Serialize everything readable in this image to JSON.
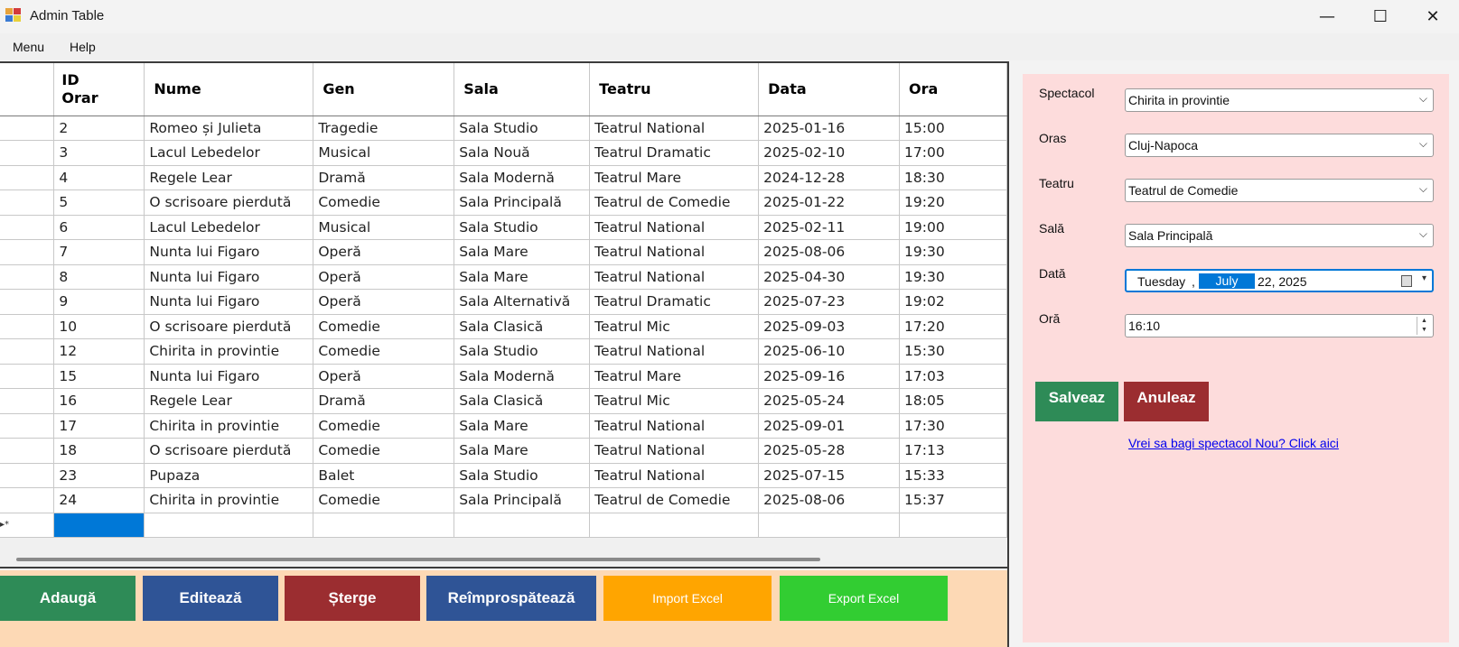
{
  "window": {
    "title": "Admin Table",
    "minimize_glyph": "—",
    "maximize_glyph": "☐",
    "close_glyph": "✕"
  },
  "menu": [
    "Menu",
    "Help"
  ],
  "table": {
    "columns": [
      "ID Orar",
      "Nume",
      "Gen",
      "Sala",
      "Teatru",
      "Data",
      "Ora"
    ],
    "new_row_marker": "▸*",
    "rows": [
      [
        "2",
        "Romeo și Julieta",
        "Tragedie",
        "Sala Studio",
        "Teatrul National",
        "2025-01-16",
        "15:00"
      ],
      [
        "3",
        "Lacul Lebedelor",
        "Musical",
        "Sala Nouă",
        "Teatrul Dramatic",
        "2025-02-10",
        "17:00"
      ],
      [
        "4",
        "Regele Lear",
        "Dramă",
        "Sala Modernă",
        "Teatrul Mare",
        "2024-12-28",
        "18:30"
      ],
      [
        "5",
        "O scrisoare pierdută",
        "Comedie",
        "Sala Principală",
        "Teatrul de Comedie",
        "2025-01-22",
        "19:20"
      ],
      [
        "6",
        "Lacul Lebedelor",
        "Musical",
        "Sala Studio",
        "Teatrul National",
        "2025-02-11",
        "19:00"
      ],
      [
        "7",
        "Nunta lui Figaro",
        "Operă",
        "Sala Mare",
        "Teatrul National",
        "2025-08-06",
        "19:30"
      ],
      [
        "8",
        "Nunta lui Figaro",
        "Operă",
        "Sala Mare",
        "Teatrul National",
        "2025-04-30",
        "19:30"
      ],
      [
        "9",
        "Nunta lui Figaro",
        "Operă",
        "Sala Alternativă",
        "Teatrul Dramatic",
        "2025-07-23",
        "19:02"
      ],
      [
        "10",
        "O scrisoare pierdută",
        "Comedie",
        "Sala Clasică",
        "Teatrul Mic",
        "2025-09-03",
        "17:20"
      ],
      [
        "12",
        "Chirita in provintie",
        "Comedie",
        "Sala Studio",
        "Teatrul National",
        "2025-06-10",
        "15:30"
      ],
      [
        "15",
        "Nunta lui Figaro",
        "Operă",
        "Sala Modernă",
        "Teatrul Mare",
        "2025-09-16",
        "17:03"
      ],
      [
        "16",
        "Regele Lear",
        "Dramă",
        "Sala Clasică",
        "Teatrul Mic",
        "2025-05-24",
        "18:05"
      ],
      [
        "17",
        "Chirita in provintie",
        "Comedie",
        "Sala Mare",
        "Teatrul National",
        "2025-09-01",
        "17:30"
      ],
      [
        "18",
        "O scrisoare pierdută",
        "Comedie",
        "Sala Mare",
        "Teatrul National",
        "2025-05-28",
        "17:13"
      ],
      [
        "23",
        "Pupaza",
        "Balet",
        "Sala Studio",
        "Teatrul National",
        "2025-07-15",
        "15:33"
      ],
      [
        "24",
        "Chirita in provintie",
        "Comedie",
        "Sala Principală",
        "Teatrul de Comedie",
        "2025-08-06",
        "15:37"
      ]
    ]
  },
  "buttons": {
    "adauga": "Adaugă",
    "editeaza": "Editează",
    "sterge": "Șterge",
    "reimprospateaza": "Reîmprospătează",
    "import_excel": "Import Excel",
    "export_excel": "Export Excel"
  },
  "form": {
    "spectacol": {
      "label": "Spectacol",
      "value": "Chirita in provintie"
    },
    "oras": {
      "label": "Oras",
      "value": "Cluj-Napoca"
    },
    "teatru": {
      "label": "Teatru",
      "value": "Teatrul de Comedie"
    },
    "sala": {
      "label": "Sală",
      "value": "Sala Principală"
    },
    "data": {
      "label": "Dată",
      "day": "Tuesday",
      "comma": ",",
      "month": "July",
      "rest": "22, 2025"
    },
    "ora": {
      "label": "Oră",
      "value": "16:10"
    },
    "save_label": "Salveaz",
    "cancel_label": "Anuleaz",
    "link_text": "Vrei sa bagi spectacol Nou? Click aici"
  },
  "colors": {
    "green": "#2e8b57",
    "blue": "#2f5496",
    "red": "#9b2d30",
    "orange": "#ffa500",
    "lime": "#32cd32",
    "panel_pink": "#fddcdc",
    "strip_peach": "#fdd9b5",
    "selection": "#0078d7"
  },
  "icons": {
    "app": "app-window-icon",
    "chevron": "chevron-down-icon",
    "calendar": "calendar-icon",
    "spin": "spin-updown-icon"
  }
}
